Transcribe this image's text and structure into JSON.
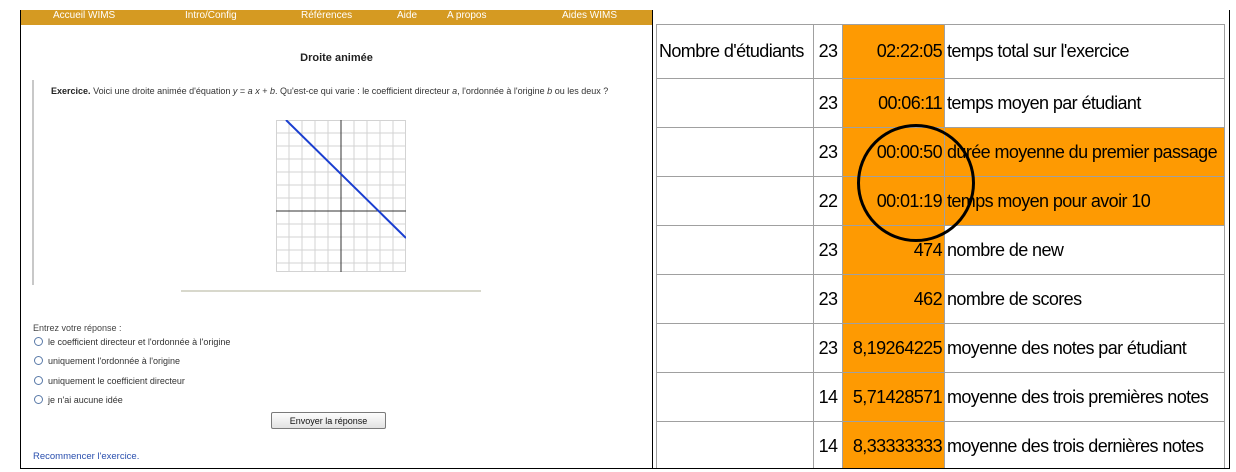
{
  "wims": {
    "nav": [
      "Accueil WIMS",
      "Intro/Config",
      "Références",
      "Aide",
      "A propos",
      "Aides WIMS"
    ],
    "title": "Droite animée",
    "exercise": {
      "label": "Exercice.",
      "text_1": "Voici une droite animée d'équation",
      "equation_y": "y",
      "equation_eq": " = ",
      "equation_a": "a",
      "equation_x": " x",
      "equation_plus": " + ",
      "equation_b": "b",
      "text_2": ". Qu'est-ce qui varie : le coefficient directeur",
      "text_a": "a",
      "text_3": ", l'ordonnée à l'origine",
      "text_b": "b",
      "text_4": "ou les deux ?"
    },
    "answer_prompt": "Entrez votre réponse :",
    "options": [
      "le coefficient directeur et l'ordonnée à l'origine",
      "uniquement l'ordonnée à l'origine",
      "uniquement le coefficient directeur",
      "je n'ai aucune idée"
    ],
    "submit_label": "Envoyer la réponse",
    "restart_link": "Recommencer l'exercice."
  },
  "stats": {
    "header_label": "Nombre d'étudiants",
    "highlight_color": "#fe9a02",
    "rows": [
      {
        "count": "23",
        "value": "02:22:05",
        "desc": "temps total sur l'exercice",
        "highlighted": false
      },
      {
        "count": "23",
        "value": "00:06:11",
        "desc": "temps moyen par étudiant",
        "highlighted": false
      },
      {
        "count": "23",
        "value": "00:00:50",
        "desc": "durée moyenne du premier passage",
        "highlighted": true
      },
      {
        "count": "22",
        "value": "00:01:19",
        "desc": "temps moyen pour avoir 10",
        "highlighted": true
      },
      {
        "count": "23",
        "value": "474",
        "desc": "nombre de new",
        "highlighted": false
      },
      {
        "count": "23",
        "value": "462",
        "desc": "nombre de scores",
        "highlighted": false
      },
      {
        "count": "23",
        "value": "8,19264225",
        "desc": "moyenne des notes par étudiant",
        "highlighted": false
      },
      {
        "count": "14",
        "value": "5,71428571",
        "desc": "moyenne des trois premières notes",
        "highlighted": false
      },
      {
        "count": "14",
        "value": "8,33333333",
        "desc": "moyenne des trois dernières notes",
        "highlighted": false
      }
    ]
  }
}
